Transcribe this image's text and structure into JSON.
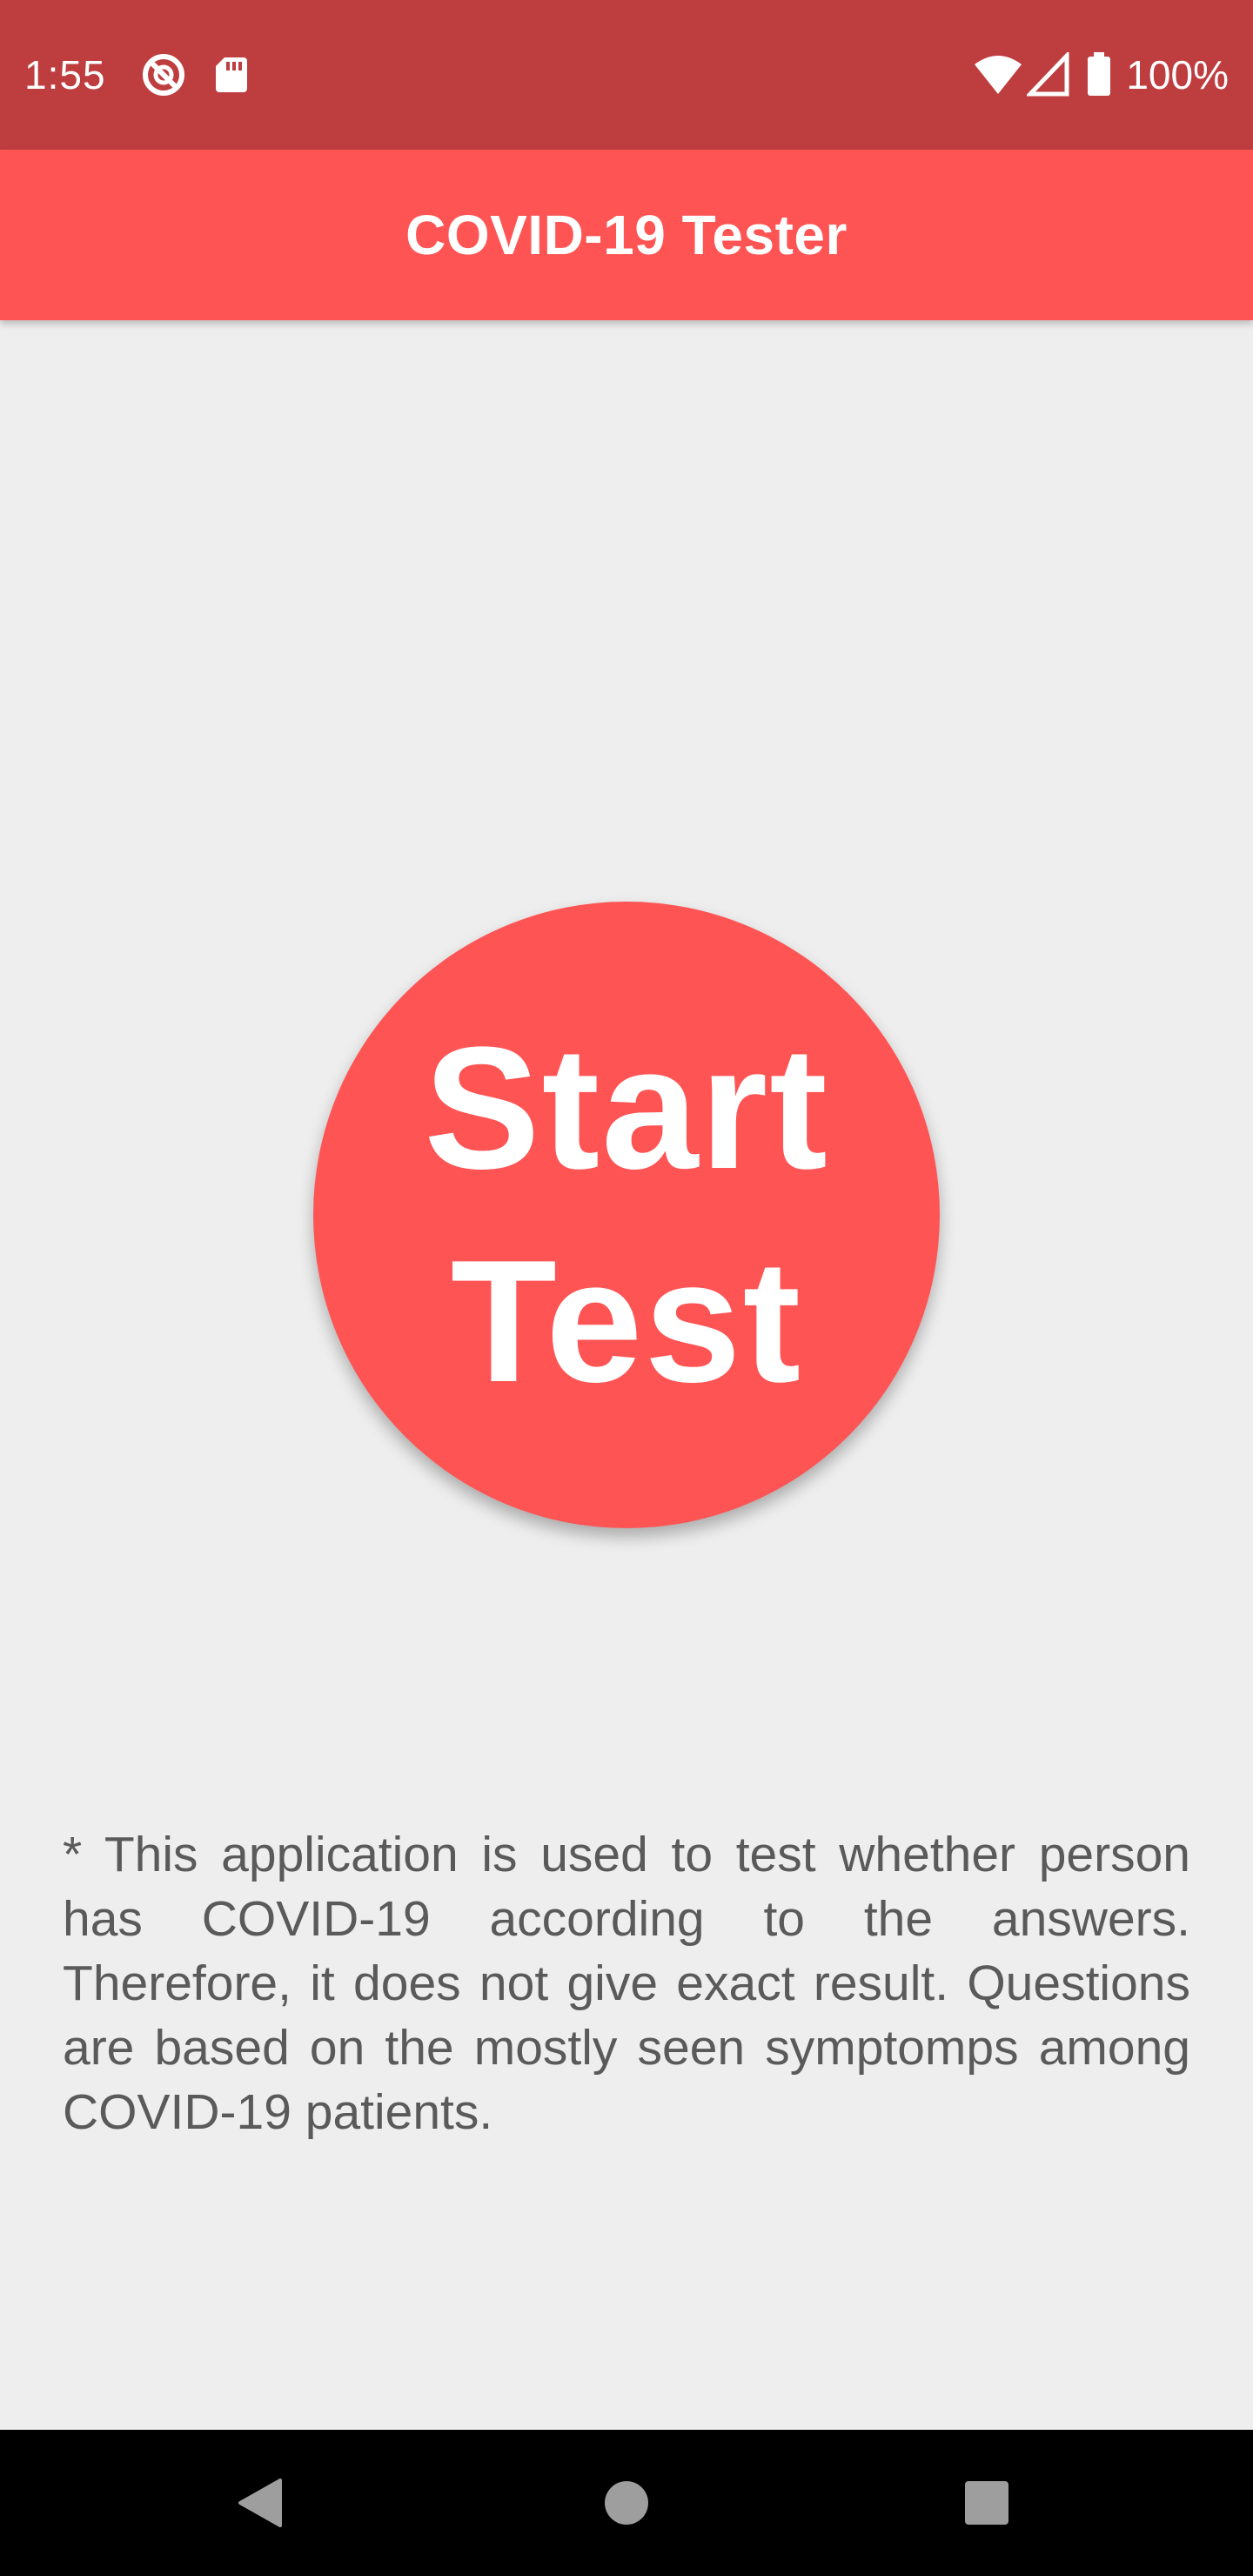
{
  "status_bar": {
    "time": "1:55",
    "battery_text": "100%",
    "icons": [
      "do-not-disturb-icon",
      "sd-card-icon",
      "wifi-icon",
      "cell-signal-icon",
      "battery-icon"
    ]
  },
  "app_bar": {
    "title": "COVID-19 Tester"
  },
  "start_button": {
    "line1": "Start",
    "line2": "Test"
  },
  "disclaimer": {
    "text": "* This application is used to test whether person has COVID-19 according to the answers. Therefore, it does not give exact result. Questions are based on the mostly seen symptomps among COVID-19 patients."
  },
  "nav_bar": {
    "icons": [
      "back-icon",
      "home-icon",
      "recents-icon"
    ]
  },
  "colors": {
    "status_bar": "#be3d3f",
    "primary": "#ff5454",
    "background": "#eeeeee",
    "disclaimer_text": "#5a5a5a"
  }
}
